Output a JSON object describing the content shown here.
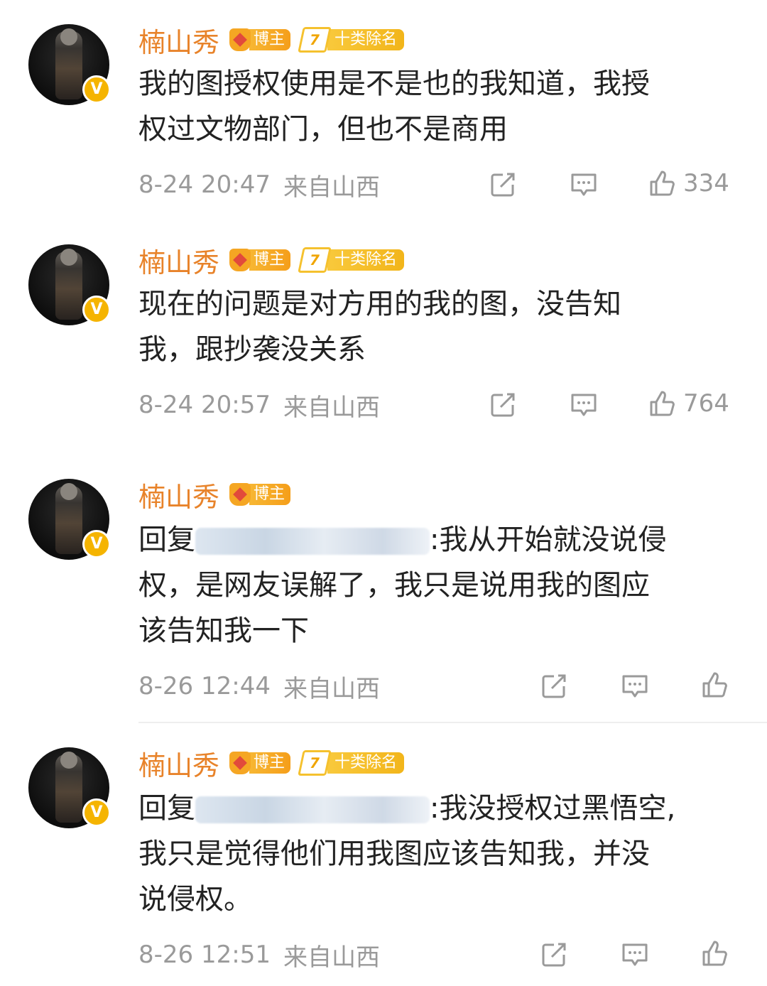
{
  "colors": {
    "name": "#e8832a",
    "badge": "#f5a623",
    "meta": "#9a9a9a"
  },
  "comments": [
    {
      "name": "楠山秀",
      "badge_blogger": "博主",
      "rank_num": "7",
      "rank_label": "十类除名",
      "lines": [
        "我的图授权使用是不是也的我知道，我授",
        "权过文物部门，但也不是商用"
      ],
      "time": "8-24 20:47",
      "location": "来自山西",
      "likes": "334"
    },
    {
      "name": "楠山秀",
      "badge_blogger": "博主",
      "rank_num": "7",
      "rank_label": "十类除名",
      "lines": [
        "现在的问题是对方用的我的图，没告知",
        "我，跟抄袭没关系"
      ],
      "time": "8-24 20:57",
      "location": "来自山西",
      "likes": "764"
    },
    {
      "name": "楠山秀",
      "badge_blogger": "博主",
      "reply_prefix": "回复",
      "line1_after": ":我从开始就没说侵",
      "lines": [
        "权，是网友误解了，我只是说用我的图应",
        "该告知我一下"
      ],
      "time": "8-26 12:44",
      "location": "来自山西"
    },
    {
      "name": "楠山秀",
      "badge_blogger": "博主",
      "rank_num": "7",
      "rank_label": "十类除名",
      "reply_prefix": "回复",
      "line1_after": ":我没授权过黑悟空,",
      "lines": [
        "我只是觉得他们用我图应该告知我，并没",
        "说侵权。"
      ],
      "time": "8-26 12:51",
      "location": "来自山西"
    }
  ],
  "icons": {
    "share": "share-icon",
    "comment": "comment-icon",
    "like": "thumbs-up-icon",
    "verified": "verified-v-icon"
  }
}
